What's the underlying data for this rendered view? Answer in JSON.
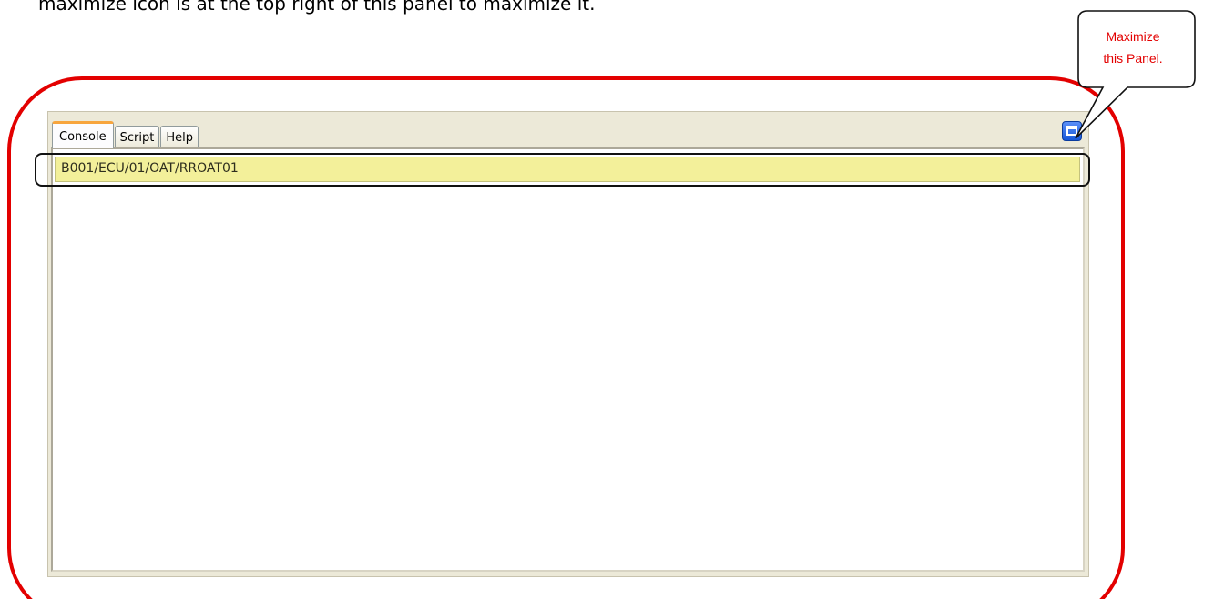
{
  "instruction_text": "maximize icon is at the top right of this panel to maximize it.",
  "callout": {
    "line1": "Maximize",
    "line2": "this Panel."
  },
  "tabs": [
    {
      "label": "Console",
      "active": true
    },
    {
      "label": "Script",
      "active": false
    },
    {
      "label": "Help",
      "active": false
    }
  ],
  "console": {
    "path": "B001/ECU/01/OAT/RROAT01"
  },
  "icons": {
    "maximize": "maximize-icon"
  },
  "colors": {
    "annotation_red": "#e30000",
    "active_tab_accent": "#f7a53d",
    "highlight_row": "#f3f09a",
    "maximize_blue": "#1657d8"
  }
}
